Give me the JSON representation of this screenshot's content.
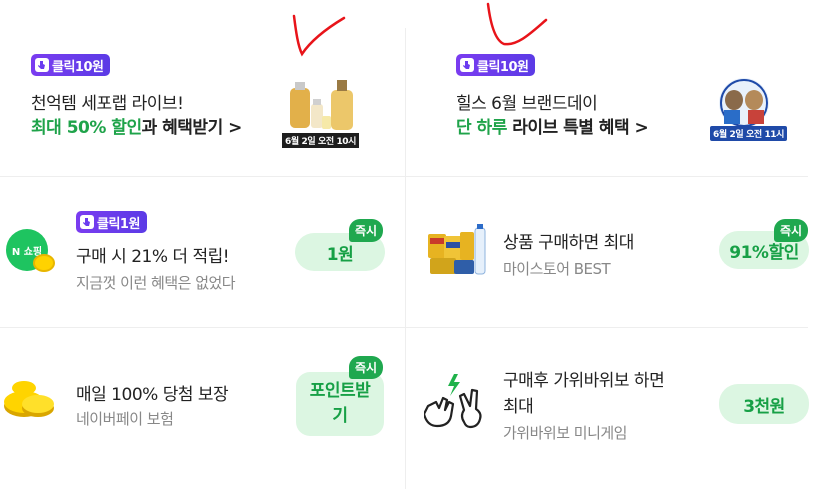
{
  "colors": {
    "accent_green": "#1fa34a",
    "badge_purple": "#6b3cf0",
    "pill_bg": "#dcf6e2"
  },
  "top_left": {
    "badge": "클릭10원",
    "line1": "천억템 세포랩 라이브!",
    "line2_green": "최대 50% 할인",
    "line2_rest": "과 혜택받기 >",
    "image_caption": "6월 2일 오전 10시"
  },
  "top_right": {
    "badge": "클릭10원",
    "line1": "힐스 6월 브랜드데이",
    "line2_green": "단 하루",
    "line2_rest": " 라이브 특별 혜택 >",
    "image_caption": "6월 2일 오전 11시"
  },
  "mid_left": {
    "badge": "클릭1원",
    "logo_text": "N 쇼핑",
    "title": "구매 시 21% 더 적립!",
    "sub": "지금껏 이런 혜택은 없었다",
    "pill": "1원",
    "tag": "즉시"
  },
  "mid_right": {
    "title": "상품 구매하면 최대",
    "sub": "마이스토어 BEST",
    "pill": "91%할인",
    "tag": "즉시"
  },
  "bot_left": {
    "title": "매일 100% 당첨 보장",
    "sub": "네이버페이 보험",
    "pill": "포인트받기",
    "tag": "즉시"
  },
  "bot_right": {
    "title_line1": "구매후 가위바위보 하면",
    "title_line2": "최대",
    "sub": "가위바위보 미니게임",
    "pill": "3천원"
  }
}
